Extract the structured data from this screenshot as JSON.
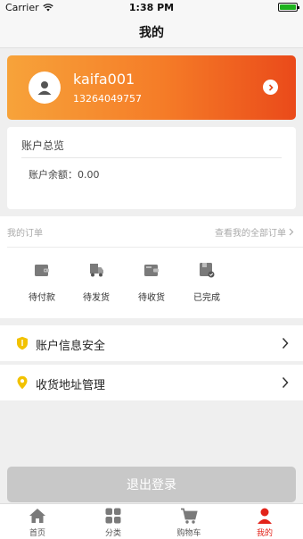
{
  "status_bar": {
    "carrier": "Carrier",
    "time": "1:38 PM",
    "battery_level": 0.85
  },
  "nav": {
    "title": "我的"
  },
  "profile": {
    "username": "kaifa001",
    "phone": "13264049757",
    "gradient_colors": [
      "#f7a33a",
      "#ea4a1a"
    ]
  },
  "account": {
    "title": "账户总览",
    "balance_label": "账户余额：0.00"
  },
  "orders": {
    "title": "我的订单",
    "view_all": "查看我的全部订单",
    "items": [
      {
        "label": "待付款",
        "icon": "wallet-icon"
      },
      {
        "label": "待发货",
        "icon": "truck-icon"
      },
      {
        "label": "待收货",
        "icon": "package-icon"
      },
      {
        "label": "已完成",
        "icon": "completed-icon"
      }
    ]
  },
  "menu": {
    "items": [
      {
        "label": "账户信息安全",
        "icon": "shield-icon"
      },
      {
        "label": "收货地址管理",
        "icon": "location-pin-icon"
      }
    ]
  },
  "logout": {
    "label": "退出登录"
  },
  "tab_bar": {
    "items": [
      {
        "label": "首页",
        "icon": "home-icon",
        "active": false
      },
      {
        "label": "分类",
        "icon": "grid-icon",
        "active": false
      },
      {
        "label": "购物车",
        "icon": "cart-icon",
        "active": false
      },
      {
        "label": "我的",
        "icon": "user-icon",
        "active": true
      }
    ],
    "active_color": "#e2231a"
  }
}
